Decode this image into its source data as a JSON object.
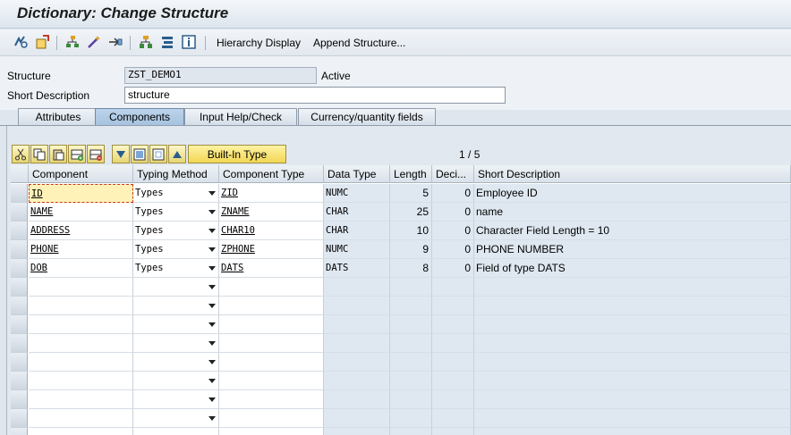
{
  "window": {
    "title": "Dictionary: Change Structure"
  },
  "toolbar": {
    "icons": [
      "display-change-icon",
      "activate-icon",
      "hierarchy-icon",
      "magic-wand-icon",
      "where-used-icon",
      "object-list-icon",
      "stack-icon",
      "info-icon"
    ],
    "hierarchy_display": "Hierarchy Display",
    "append_structure": "Append Structure..."
  },
  "form": {
    "structure_label": "Structure",
    "structure_value": "ZST_DEMO1",
    "status": "Active",
    "short_desc_label": "Short Description",
    "short_desc_value": "structure"
  },
  "tabs": [
    {
      "label": "Attributes",
      "active": false
    },
    {
      "label": "Components",
      "active": true
    },
    {
      "label": "Input Help/Check",
      "active": false
    },
    {
      "label": "Currency/quantity fields",
      "active": false
    }
  ],
  "table_controls": {
    "builtin_type": "Built-In Type",
    "page": "1",
    "page_sep": "/",
    "page_total": "5"
  },
  "columns": [
    "Component",
    "Typing Method",
    "Component Type",
    "Data Type",
    "Length",
    "Deci...",
    "Short Description"
  ],
  "rows": [
    {
      "component": "ID",
      "typing": "Types",
      "comp_type": "ZID",
      "data_type": "NUMC",
      "length": "5",
      "decimals": "0",
      "desc": "Employee ID"
    },
    {
      "component": "NAME",
      "typing": "Types",
      "comp_type": "ZNAME",
      "data_type": "CHAR",
      "length": "25",
      "decimals": "0",
      "desc": "name"
    },
    {
      "component": "ADDRESS",
      "typing": "Types",
      "comp_type": "CHAR10",
      "data_type": "CHAR",
      "length": "10",
      "decimals": "0",
      "desc": "Character Field Length = 10"
    },
    {
      "component": "PHONE",
      "typing": "Types",
      "comp_type": "ZPHONE",
      "data_type": "NUMC",
      "length": "9",
      "decimals": "0",
      "desc": "PHONE NUMBER"
    },
    {
      "component": "DOB",
      "typing": "Types",
      "comp_type": "DATS",
      "data_type": "DATS",
      "length": "8",
      "decimals": "0",
      "desc": "Field of type DATS"
    }
  ]
}
